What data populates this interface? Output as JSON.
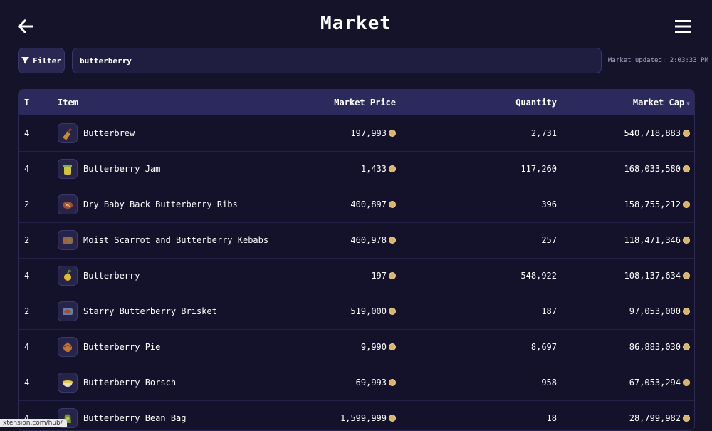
{
  "header": {
    "title": "Market"
  },
  "toolbar": {
    "filter_label": "Filter",
    "search_value": "butterberry",
    "updated_text": "Market updated: 2:03:33 PM"
  },
  "table": {
    "columns": {
      "t": "T",
      "item": "Item",
      "price": "Market Price",
      "qty": "Quantity",
      "cap": "Market Cap"
    },
    "sort": {
      "column": "Market Cap",
      "direction": "descending"
    },
    "rows": [
      {
        "t": "4",
        "name": "Butterbrew",
        "price": "197,993",
        "qty": "2,731",
        "cap": "540,718,883",
        "icon": "bottle-icon"
      },
      {
        "t": "4",
        "name": "Butterberry Jam",
        "price": "1,433",
        "qty": "117,260",
        "cap": "168,033,580",
        "icon": "jam-jar-icon"
      },
      {
        "t": "2",
        "name": "Dry Baby Back Butterberry Ribs",
        "price": "400,897",
        "qty": "396",
        "cap": "158,755,212",
        "icon": "ribs-icon"
      },
      {
        "t": "2",
        "name": "Moist Scarrot and Butterberry Kebabs",
        "price": "460,978",
        "qty": "257",
        "cap": "118,471,346",
        "icon": "kebab-icon"
      },
      {
        "t": "4",
        "name": "Butterberry",
        "price": "197",
        "qty": "548,922",
        "cap": "108,137,634",
        "icon": "berry-icon"
      },
      {
        "t": "2",
        "name": "Starry Butterberry Brisket",
        "price": "519,000",
        "qty": "187",
        "cap": "97,053,000",
        "icon": "brisket-icon"
      },
      {
        "t": "4",
        "name": "Butterberry Pie",
        "price": "9,990",
        "qty": "8,697",
        "cap": "86,883,030",
        "icon": "pie-icon"
      },
      {
        "t": "4",
        "name": "Butterberry Borsch",
        "price": "69,993",
        "qty": "958",
        "cap": "67,053,294",
        "icon": "soup-bowl-icon"
      },
      {
        "t": "4",
        "name": "Butterberry Bean Bag",
        "price": "1,599,999",
        "qty": "18",
        "cap": "28,799,982",
        "icon": "bean-bag-icon"
      }
    ]
  },
  "status_bar": {
    "url": "xtension.com/hub/"
  },
  "colors": {
    "background": "#14132a",
    "header_row": "#2c2a5c",
    "coin": "#d9b46a",
    "border": "#3a3868"
  }
}
